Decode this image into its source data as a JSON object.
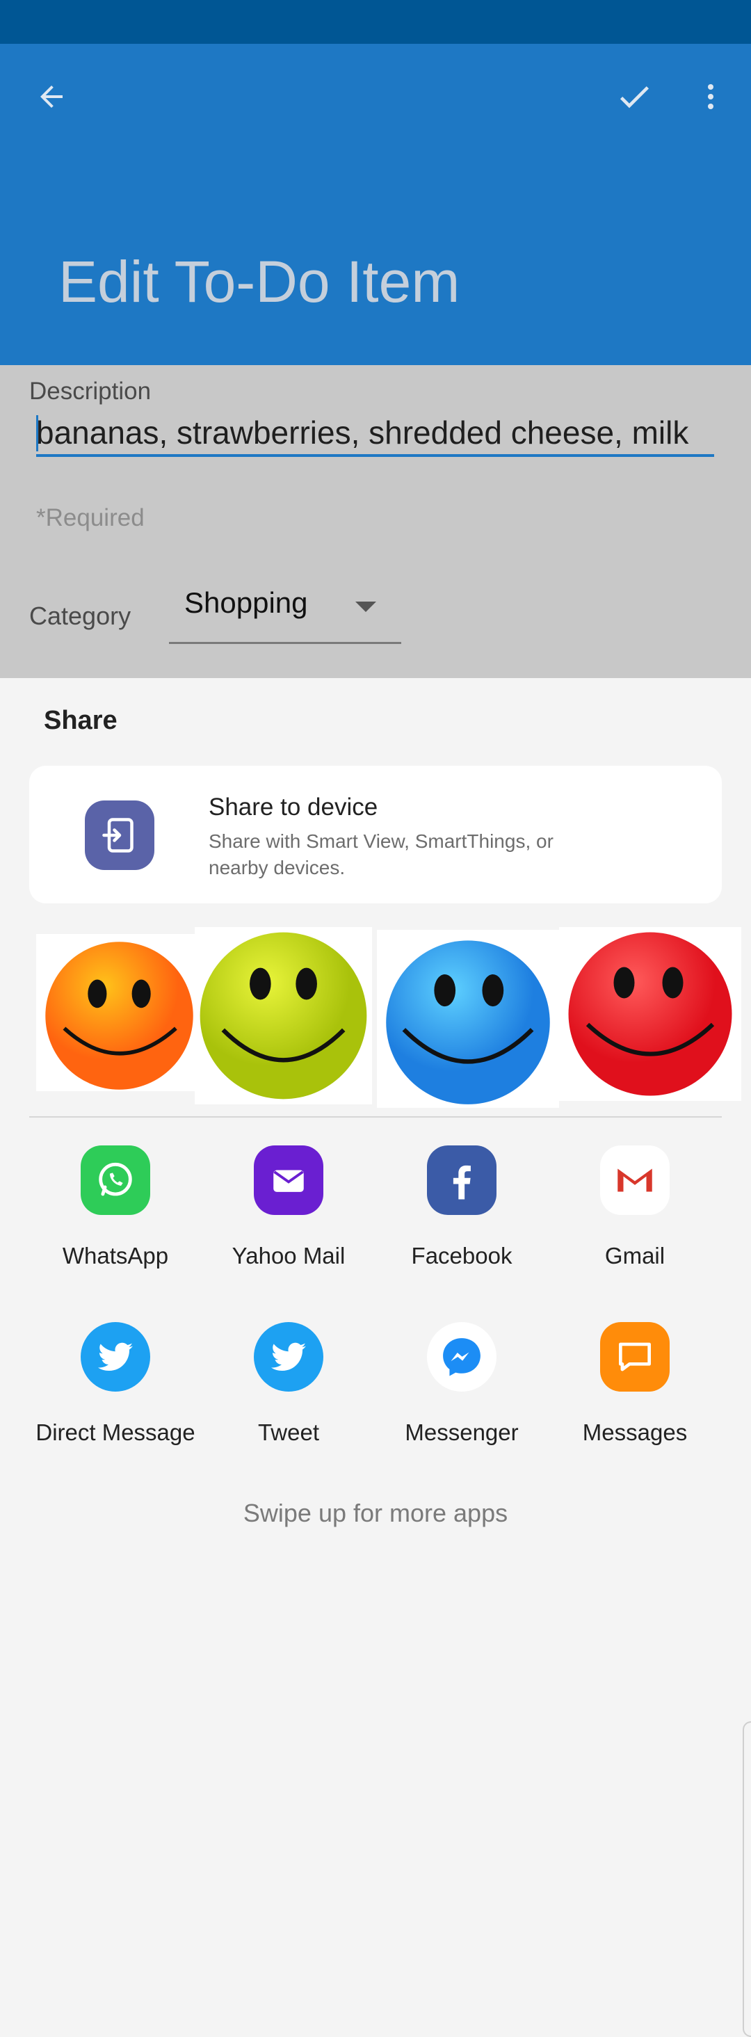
{
  "appbar": {
    "title": "Edit To-Do Item",
    "back_icon": "arrow-left-icon",
    "confirm_icon": "check-icon",
    "menu_icon": "more-vert-icon",
    "color": "#1e78c4"
  },
  "form": {
    "description_label": "Description",
    "description_value": "bananas, strawberries,  shredded cheese,  milk",
    "required_note": "*Required",
    "category_label": "Category",
    "category_value": "Shopping"
  },
  "share": {
    "title": "Share",
    "device": {
      "title": "Share to device",
      "subtitle": "Share with Smart View, SmartThings, or nearby devices.",
      "icon": "share-to-device-icon"
    },
    "smileys": [
      "orange-smiley",
      "yellow-green-smiley",
      "blue-smiley",
      "red-smiley"
    ],
    "apps": [
      {
        "label": "WhatsApp",
        "icon": "whatsapp-icon",
        "color": "#2ecc58"
      },
      {
        "label": "Yahoo Mail",
        "icon": "yahoo-mail-icon",
        "color": "#6a1fd1"
      },
      {
        "label": "Facebook",
        "icon": "facebook-icon",
        "color": "#3b5ba7"
      },
      {
        "label": "Gmail",
        "icon": "gmail-icon",
        "color": "#ffffff"
      },
      {
        "label": "Direct Message",
        "icon": "twitter-icon",
        "color": "#1da1f2"
      },
      {
        "label": "Tweet",
        "icon": "twitter-icon",
        "color": "#1da1f2"
      },
      {
        "label": "Messenger",
        "icon": "messenger-icon",
        "color": "#ffffff"
      },
      {
        "label": "Messages",
        "icon": "messages-icon",
        "color": "#ff8c0a"
      }
    ],
    "hint": "Swipe up for more apps"
  }
}
